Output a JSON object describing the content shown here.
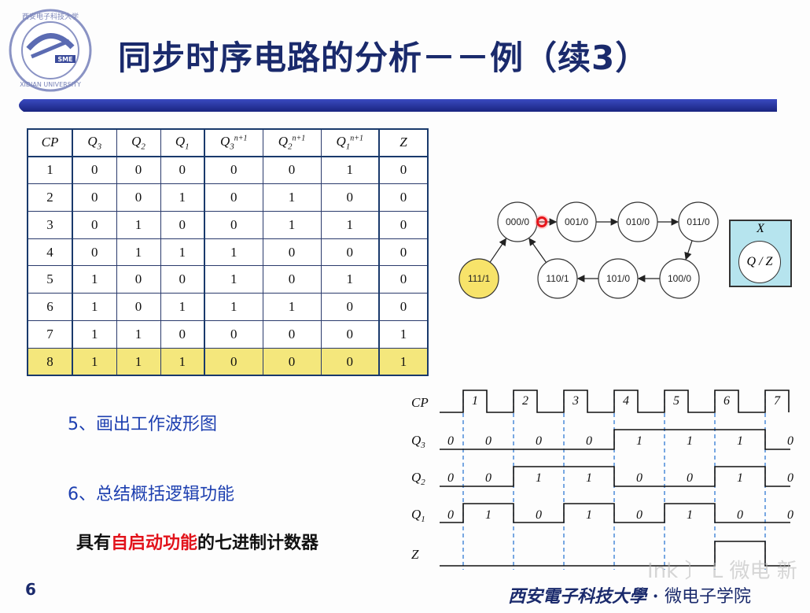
{
  "header": {
    "title": "同步时序电路的分析－－例（续3）",
    "logo": {
      "icon": "xidian-university-emblem",
      "top_text": "西安电子科技大学",
      "bottom_text": "XIDIAN UNIVERSITY",
      "badge": "SME"
    }
  },
  "colors": {
    "title": "#1a2a6c",
    "accent_bar": "#1f2c8f",
    "table_highlight": "#f4e77c",
    "state_highlight": "#f7e36a",
    "legend_bg": "#b6e4ee",
    "step_text": "#1d3fb0",
    "emphasis": "#e2131b",
    "dashed_line": "#1f6fd0"
  },
  "truth_table": {
    "headers": [
      {
        "base": "CP",
        "sub": "",
        "sup": ""
      },
      {
        "base": "Q",
        "sub": "3",
        "sup": ""
      },
      {
        "base": "Q",
        "sub": "2",
        "sup": ""
      },
      {
        "base": "Q",
        "sub": "1",
        "sup": ""
      },
      {
        "base": "Q",
        "sub": "3",
        "sup": "n+1"
      },
      {
        "base": "Q",
        "sub": "2",
        "sup": "n+1"
      },
      {
        "base": "Q",
        "sub": "1",
        "sup": "n+1"
      },
      {
        "base": "Z",
        "sub": "",
        "sup": ""
      }
    ],
    "rows": [
      [
        "1",
        "0",
        "0",
        "0",
        "0",
        "0",
        "1",
        "0"
      ],
      [
        "2",
        "0",
        "0",
        "1",
        "0",
        "1",
        "0",
        "0"
      ],
      [
        "3",
        "0",
        "1",
        "0",
        "0",
        "1",
        "1",
        "0"
      ],
      [
        "4",
        "0",
        "1",
        "1",
        "1",
        "0",
        "0",
        "0"
      ],
      [
        "5",
        "1",
        "0",
        "0",
        "1",
        "0",
        "1",
        "0"
      ],
      [
        "6",
        "1",
        "0",
        "1",
        "1",
        "1",
        "0",
        "0"
      ],
      [
        "7",
        "1",
        "1",
        "0",
        "0",
        "0",
        "0",
        "1"
      ],
      [
        "8",
        "1",
        "1",
        "1",
        "0",
        "0",
        "0",
        "1"
      ]
    ],
    "highlight_row": 8
  },
  "state_diagram": {
    "states": [
      "000/0",
      "001/0",
      "010/0",
      "011/0",
      "100/0",
      "101/0",
      "110/1",
      "111/1"
    ],
    "transitions": [
      [
        "000/0",
        "001/0"
      ],
      [
        "001/0",
        "010/0"
      ],
      [
        "010/0",
        "011/0"
      ],
      [
        "011/0",
        "100/0"
      ],
      [
        "100/0",
        "101/0"
      ],
      [
        "101/0",
        "110/1"
      ],
      [
        "110/1",
        "000/0"
      ],
      [
        "111/1",
        "000/0"
      ]
    ],
    "highlighted_state": "111/1",
    "cursor_icon": "laser-pointer-dot",
    "legend": {
      "input": "X",
      "node": "Q / Z"
    }
  },
  "steps": {
    "step5": "5、画出工作波形图",
    "step6": "6、总结概括逻辑功能"
  },
  "conclusion": {
    "prefix": "具有",
    "emphasis": "自启动功能",
    "suffix": "的七进制计数器"
  },
  "waveform": {
    "signals": [
      {
        "name": "CP",
        "sub": ""
      },
      {
        "name": "Q",
        "sub": "3"
      },
      {
        "name": "Q",
        "sub": "2"
      },
      {
        "name": "Q",
        "sub": "1"
      },
      {
        "name": "Z",
        "sub": ""
      }
    ],
    "clock_labels": [
      "1",
      "2",
      "3",
      "4",
      "5",
      "6",
      "7"
    ],
    "initial": {
      "Q3": "0",
      "Q2": "0",
      "Q1": "0"
    },
    "q3_values": [
      "0",
      "0",
      "0",
      "1",
      "1",
      "1",
      "0"
    ],
    "q2_values": [
      "0",
      "1",
      "1",
      "0",
      "0",
      "1",
      "0"
    ],
    "q1_values": [
      "1",
      "0",
      "1",
      "0",
      "1",
      "0",
      "0"
    ],
    "z_levels": [
      0,
      0,
      0,
      0,
      0,
      1,
      0
    ]
  },
  "footer": {
    "page_number": "6",
    "school": "西安電子科技大學",
    "separator": "·",
    "college": "微电子学院",
    "watermark": "Ink 〕 L 微电 新"
  }
}
